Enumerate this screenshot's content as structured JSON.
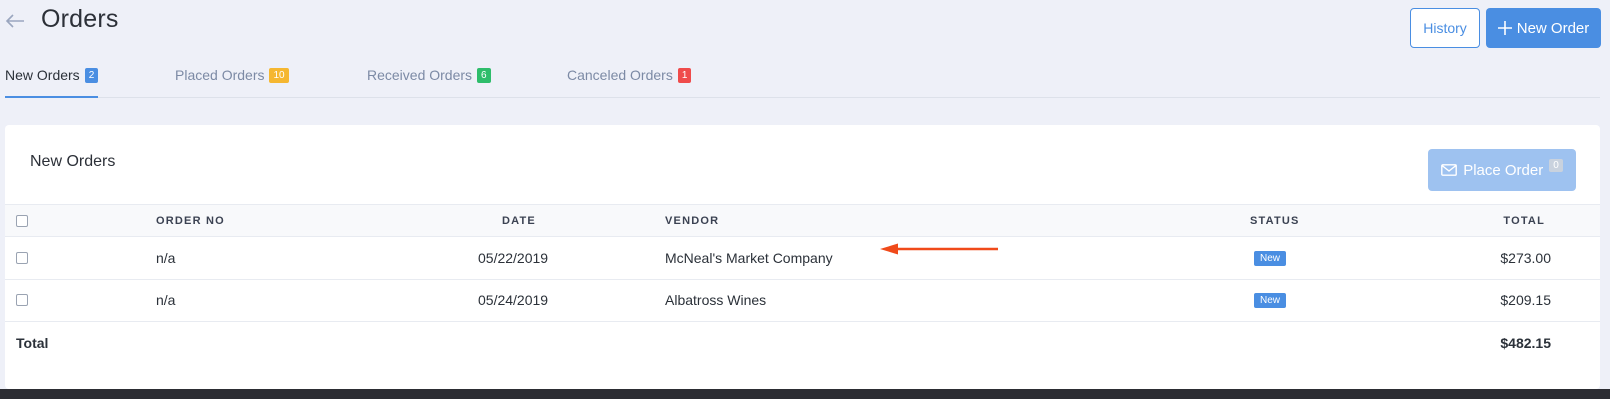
{
  "header": {
    "title": "Orders",
    "history_label": "History",
    "new_order_label": "New Order"
  },
  "tabs": [
    {
      "label": "New Orders",
      "count": "2",
      "badge_color": "#4a8ee2",
      "active": true
    },
    {
      "label": "Placed Orders",
      "count": "10",
      "badge_color": "#f5b731",
      "active": false
    },
    {
      "label": "Received Orders",
      "count": "6",
      "badge_color": "#2ebd6b",
      "active": false
    },
    {
      "label": "Canceled Orders",
      "count": "1",
      "badge_color": "#ef4b4b",
      "active": false
    }
  ],
  "card": {
    "title": "New Orders",
    "place_order_label": "Place Order",
    "place_order_count": "0"
  },
  "table": {
    "columns": [
      "ORDER NO",
      "DATE",
      "VENDOR",
      "STATUS",
      "TOTAL"
    ],
    "rows": [
      {
        "order_no": "n/a",
        "date": "05/22/2019",
        "vendor": "McNeal's Market Company",
        "status": "New",
        "total": "$273.00"
      },
      {
        "order_no": "n/a",
        "date": "05/24/2019",
        "vendor": "Albatross Wines",
        "status": "New",
        "total": "$209.15"
      }
    ],
    "total_label": "Total",
    "total_value": "$482.15"
  },
  "colors": {
    "accent": "#4a8ee2",
    "annotation_arrow": "#f04a1a"
  },
  "icons": {
    "back": "arrow-left-icon",
    "new_order": "plus-icon",
    "place_order": "envelope-icon"
  }
}
